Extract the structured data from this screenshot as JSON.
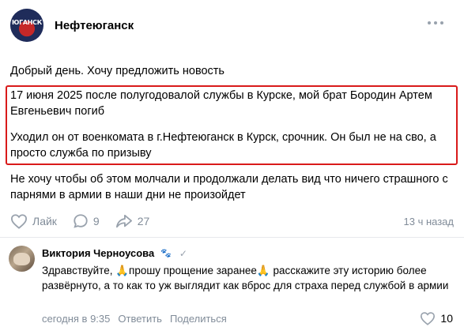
{
  "group": {
    "logo_text": "ЮГАНСК",
    "name": "Нефтеюганск"
  },
  "post": {
    "greeting": "Добрый день. Хочу предложить новость",
    "highlight_paragraph_1": "17 июня 2025 после полугодовалой службы в Курске, мой брат Бородин Артем Евгеньевич погиб",
    "highlight_paragraph_2": "Уходил он от военкомата в г.Нефтеюганск в Курск, срочник. Он был не на сво, а просто служба по призыву",
    "after_text": "Не хочу чтобы об этом молчали и продолжали делать вид что ничего страшного с парнями в армии в наши дни не произойдет",
    "highlight_color": "#d91a1a"
  },
  "actions": {
    "like_label": "Лайк",
    "comments_count": "9",
    "shares_count": "27",
    "time_ago": "13 ч назад"
  },
  "comment": {
    "author": "Виктория Черноусова",
    "author_badge": "🐾",
    "verified_mark": "✓",
    "text_part_1": "Здравствуйте, ",
    "emoji_1": "🙏",
    "text_part_2": "прошу прощение заранее",
    "emoji_2": "🙏",
    "text_part_3": " расскажите эту историю более развёрнуто, а то как то уж выглядит как вброс для страха перед службой в армии",
    "time": "сегодня в 9:35",
    "reply_label": "Ответить",
    "share_label": "Поделиться",
    "likes": "10"
  }
}
